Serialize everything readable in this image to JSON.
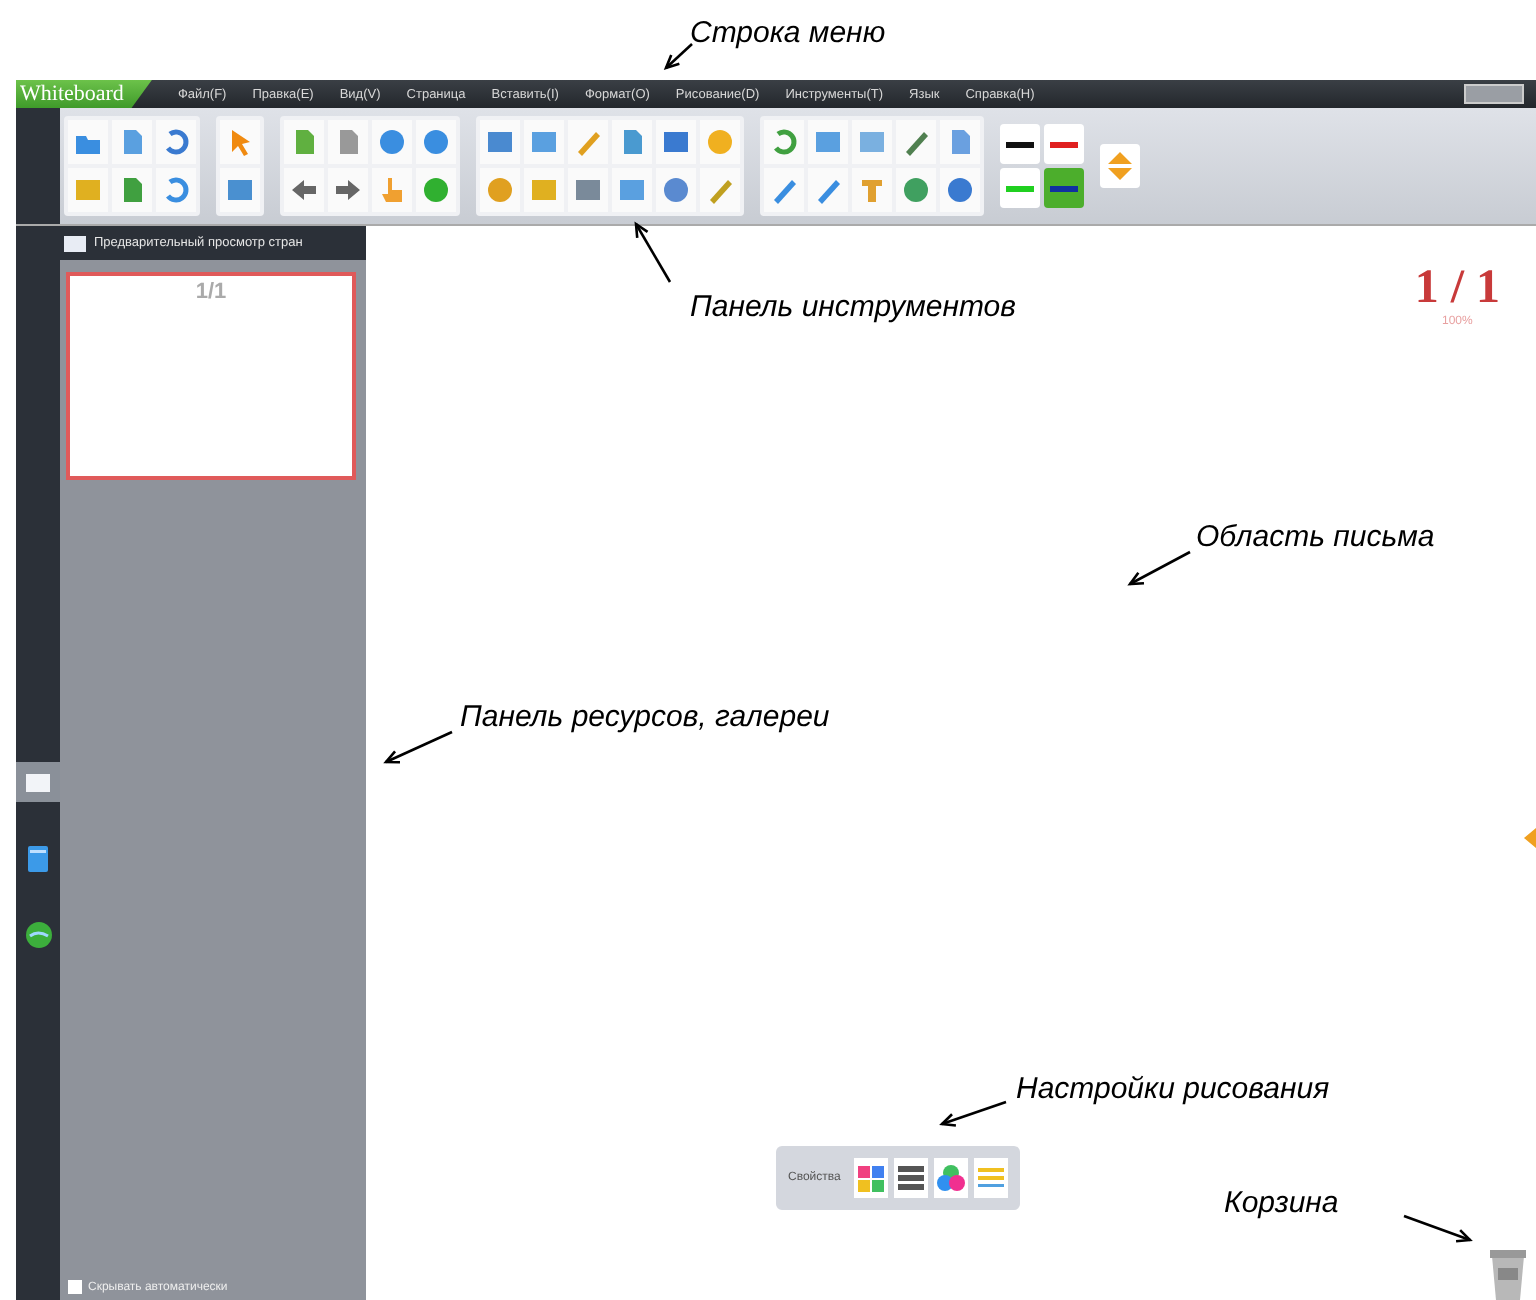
{
  "menu_bar": {
    "logo": "Whiteboard",
    "items": [
      "Файл(F)",
      "Правка(E)",
      "Вид(V)",
      "Страница",
      "Вставить(I)",
      "Формат(O)",
      "Рисование(D)",
      "Инструменты(T)",
      "Язык",
      "Справка(H)"
    ]
  },
  "pen_colors": [
    {
      "color": "#111111",
      "selected": false
    },
    {
      "color": "#e02020",
      "selected": false
    },
    {
      "color": "#20d020",
      "selected": false
    },
    {
      "color": "#1030a0",
      "selected": true
    }
  ],
  "page_preview": {
    "title": "Предварительный просмотр стран",
    "thumbnails": [
      {
        "label": "1/1",
        "selected": true
      }
    ]
  },
  "resource_tabs": [
    {
      "selected": true
    },
    {
      "selected": false
    },
    {
      "selected": false
    }
  ],
  "auto_hide": {
    "label": "Скрывать автоматически",
    "checked": false
  },
  "canvas": {
    "page_counter": "1 / 1",
    "zoom": "100%"
  },
  "properties_bar": {
    "label": "Свойства"
  },
  "annotations": [
    {
      "text": "Строка меню"
    },
    {
      "text": "Панель инструментов"
    },
    {
      "text": "Область письма"
    },
    {
      "text": "Панель ресурсов, галереи"
    },
    {
      "text": "Настройки рисования"
    },
    {
      "text": "Корзина"
    }
  ]
}
